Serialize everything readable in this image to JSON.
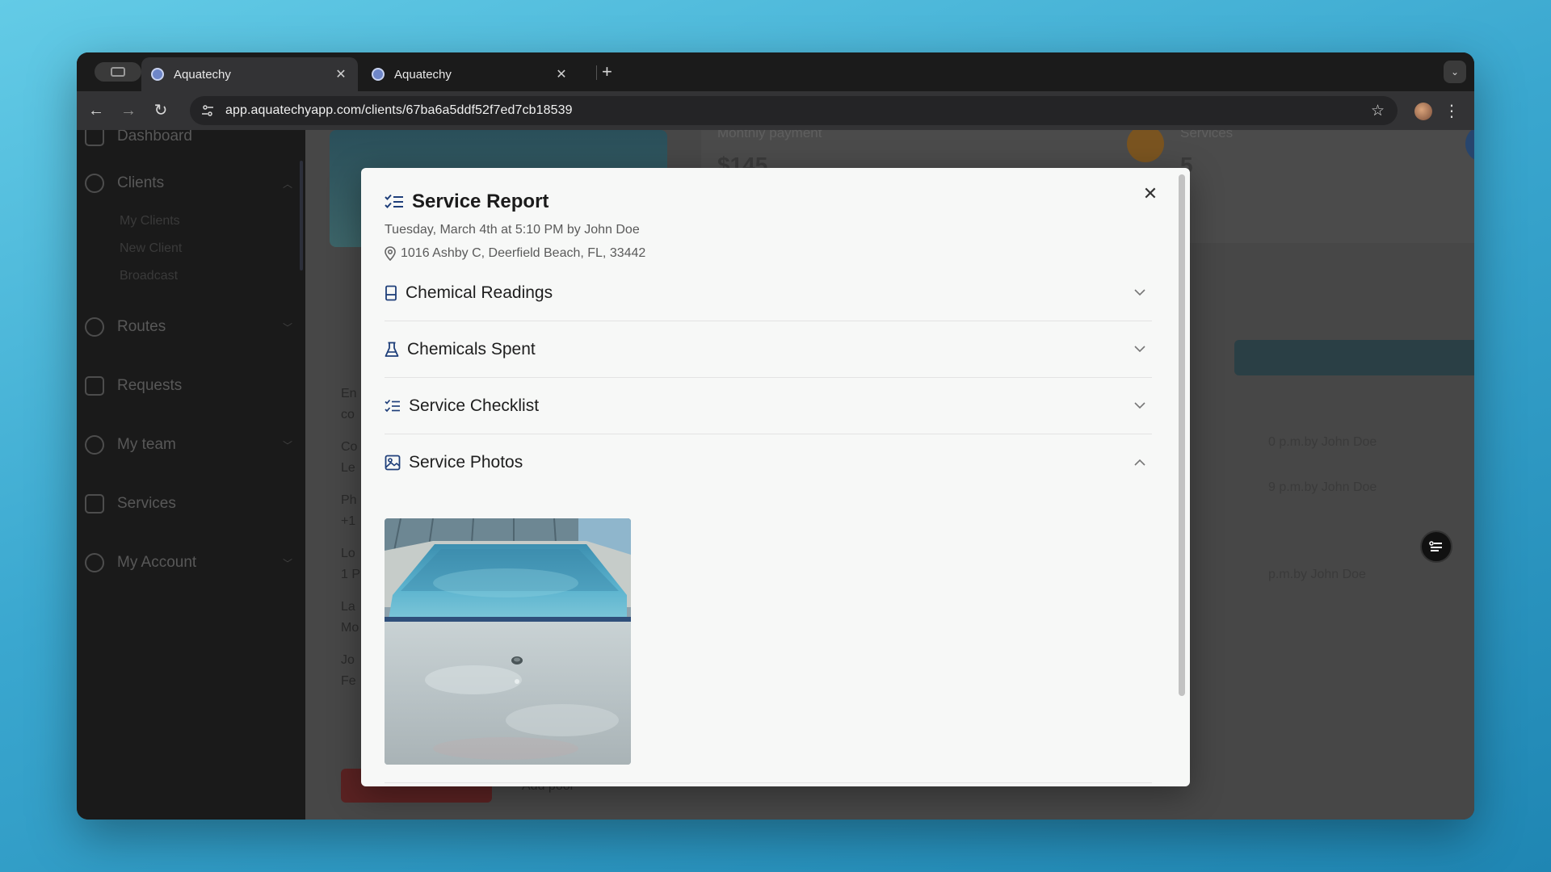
{
  "browser": {
    "tabs": [
      {
        "title": "Aquatechy",
        "active": true
      },
      {
        "title": "Aquatechy",
        "active": false
      }
    ],
    "url": "app.aquatechyapp.com/clients/67ba6a5ddf52f7ed7cb18539"
  },
  "sidebar": {
    "items": [
      {
        "label": "Dashboard",
        "icon": "dashboard-icon"
      },
      {
        "label": "Clients",
        "icon": "users-icon"
      },
      {
        "label": "Routes",
        "icon": "map-pin-icon"
      },
      {
        "label": "Requests",
        "icon": "checkbox-icon"
      },
      {
        "label": "My team",
        "icon": "team-icon"
      },
      {
        "label": "Services",
        "icon": "checklist-icon"
      },
      {
        "label": "My Account",
        "icon": "account-icon"
      }
    ],
    "client_subitems": [
      "My Clients",
      "New Client",
      "Broadcast"
    ]
  },
  "background": {
    "monthly_payment_label": "Monthly payment",
    "monthly_payment_value": "$145",
    "services_label": "Services",
    "services_value": "5",
    "service_rows": [
      "0 p.m.by John Doe",
      "9 p.m.by John Doe",
      "p.m.by John Doe"
    ],
    "add_pool_label": "Add pool"
  },
  "modal": {
    "title": "Service Report",
    "meta": "Tuesday, March 4th at 5:10 PM by John Doe",
    "address": "1016 Ashby C, Deerfield Beach, FL, 33442",
    "sections": [
      {
        "label": "Chemical Readings",
        "icon": "beaker-icon",
        "expanded": false
      },
      {
        "label": "Chemicals Spent",
        "icon": "flask-icon",
        "expanded": false
      },
      {
        "label": "Service Checklist",
        "icon": "checklist-icon",
        "expanded": false
      },
      {
        "label": "Service Photos",
        "icon": "image-icon",
        "expanded": true
      }
    ]
  },
  "colors": {
    "accent_bar": "#1f4d5c",
    "payment_dot": "#d98b1a",
    "services_dot": "#2a6ec0",
    "danger_button": "#b52b2b"
  }
}
